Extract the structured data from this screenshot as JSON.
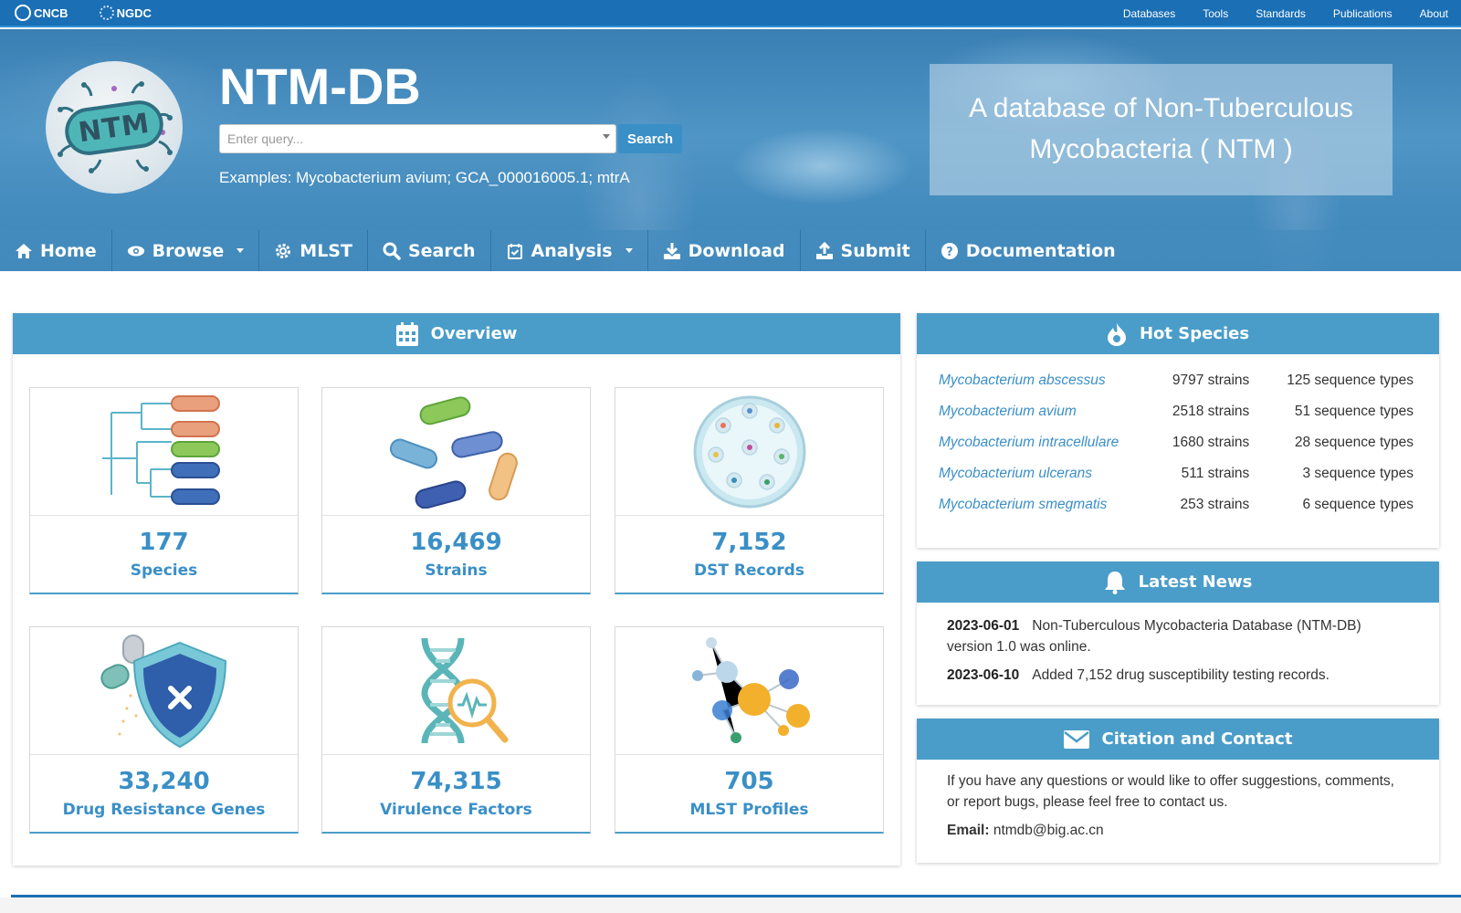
{
  "topbar": {
    "brand1": "CNCB",
    "brand2": "NGDC",
    "links": [
      "Databases",
      "Tools",
      "Standards",
      "Publications",
      "About"
    ]
  },
  "header": {
    "logo_text": "NTM",
    "title": "NTM-DB",
    "search_placeholder": "Enter query...",
    "search_button": "Search",
    "examples": "Examples: Mycobacterium avium; GCA_000016005.1; mtrA",
    "tagline_line1": "A database of Non-Tuberculous",
    "tagline_line2": "Mycobacteria ( NTM )"
  },
  "nav": {
    "home": "Home",
    "browse": "Browse",
    "mlst": "MLST",
    "search": "Search",
    "analysis": "Analysis",
    "download": "Download",
    "submit": "Submit",
    "documentation": "Documentation"
  },
  "overview": {
    "title": "Overview",
    "stats": [
      {
        "value": "177",
        "label": "Species"
      },
      {
        "value": "16,469",
        "label": "Strains"
      },
      {
        "value": "7,152",
        "label": "DST Records"
      },
      {
        "value": "33,240",
        "label": "Drug Resistance Genes"
      },
      {
        "value": "74,315",
        "label": "Virulence Factors"
      },
      {
        "value": "705",
        "label": "MLST Profiles"
      }
    ]
  },
  "hot_species": {
    "title": "Hot Species",
    "rows": [
      {
        "species": "Mycobacterium abscessus",
        "strains": "9797 strains",
        "types": "125 sequence types"
      },
      {
        "species": "Mycobacterium avium",
        "strains": "2518 strains",
        "types": "51 sequence types"
      },
      {
        "species": "Mycobacterium intracellulare",
        "strains": "1680 strains",
        "types": "28 sequence types"
      },
      {
        "species": "Mycobacterium ulcerans",
        "strains": "511 strains",
        "types": "3 sequence types"
      },
      {
        "species": "Mycobacterium smegmatis",
        "strains": "253 strains",
        "types": "6 sequence types"
      }
    ]
  },
  "news": {
    "title": "Latest News",
    "items": [
      {
        "date": "2023-06-01",
        "text": "Non-Tuberculous Mycobacteria Database (NTM-DB) version 1.0 was online."
      },
      {
        "date": "2023-06-10",
        "text": "Added 7,152 drug susceptibility testing records."
      }
    ]
  },
  "contact": {
    "title": "Citation and Contact",
    "text": "If you have any questions or would like to offer suggestions, comments, or report bugs, please feel free to contact us.",
    "email_label": "Email:",
    "email": "ntmdb@big.ac.cn"
  },
  "colors": {
    "accent": "#4a9dc9",
    "topbar": "#1a6fb5",
    "link": "#3a8fc7"
  }
}
